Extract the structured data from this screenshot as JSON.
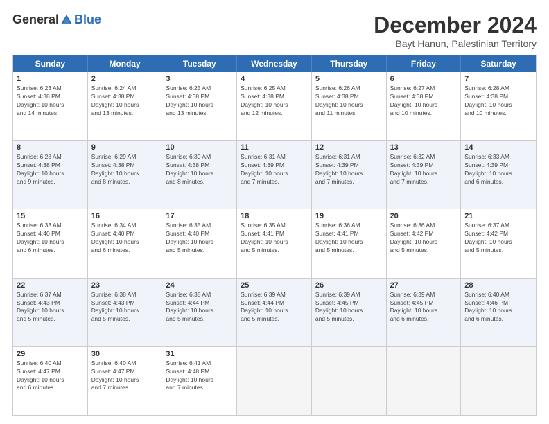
{
  "logo": {
    "general": "General",
    "blue": "Blue"
  },
  "title": "December 2024",
  "subtitle": "Bayt Hanun, Palestinian Territory",
  "days_of_week": [
    "Sunday",
    "Monday",
    "Tuesday",
    "Wednesday",
    "Thursday",
    "Friday",
    "Saturday"
  ],
  "weeks": [
    [
      {
        "day": "1",
        "info": "Sunrise: 6:23 AM\nSunset: 4:38 PM\nDaylight: 10 hours\nand 14 minutes.",
        "shade": false
      },
      {
        "day": "2",
        "info": "Sunrise: 6:24 AM\nSunset: 4:38 PM\nDaylight: 10 hours\nand 13 minutes.",
        "shade": false
      },
      {
        "day": "3",
        "info": "Sunrise: 6:25 AM\nSunset: 4:38 PM\nDaylight: 10 hours\nand 13 minutes.",
        "shade": false
      },
      {
        "day": "4",
        "info": "Sunrise: 6:25 AM\nSunset: 4:38 PM\nDaylight: 10 hours\nand 12 minutes.",
        "shade": false
      },
      {
        "day": "5",
        "info": "Sunrise: 6:26 AM\nSunset: 4:38 PM\nDaylight: 10 hours\nand 11 minutes.",
        "shade": false
      },
      {
        "day": "6",
        "info": "Sunrise: 6:27 AM\nSunset: 4:38 PM\nDaylight: 10 hours\nand 10 minutes.",
        "shade": false
      },
      {
        "day": "7",
        "info": "Sunrise: 6:28 AM\nSunset: 4:38 PM\nDaylight: 10 hours\nand 10 minutes.",
        "shade": false
      }
    ],
    [
      {
        "day": "8",
        "info": "Sunrise: 6:28 AM\nSunset: 4:38 PM\nDaylight: 10 hours\nand 9 minutes.",
        "shade": true
      },
      {
        "day": "9",
        "info": "Sunrise: 6:29 AM\nSunset: 4:38 PM\nDaylight: 10 hours\nand 8 minutes.",
        "shade": true
      },
      {
        "day": "10",
        "info": "Sunrise: 6:30 AM\nSunset: 4:38 PM\nDaylight: 10 hours\nand 8 minutes.",
        "shade": true
      },
      {
        "day": "11",
        "info": "Sunrise: 6:31 AM\nSunset: 4:39 PM\nDaylight: 10 hours\nand 7 minutes.",
        "shade": true
      },
      {
        "day": "12",
        "info": "Sunrise: 6:31 AM\nSunset: 4:39 PM\nDaylight: 10 hours\nand 7 minutes.",
        "shade": true
      },
      {
        "day": "13",
        "info": "Sunrise: 6:32 AM\nSunset: 4:39 PM\nDaylight: 10 hours\nand 7 minutes.",
        "shade": true
      },
      {
        "day": "14",
        "info": "Sunrise: 6:33 AM\nSunset: 4:39 PM\nDaylight: 10 hours\nand 6 minutes.",
        "shade": true
      }
    ],
    [
      {
        "day": "15",
        "info": "Sunrise: 6:33 AM\nSunset: 4:40 PM\nDaylight: 10 hours\nand 6 minutes.",
        "shade": false
      },
      {
        "day": "16",
        "info": "Sunrise: 6:34 AM\nSunset: 4:40 PM\nDaylight: 10 hours\nand 6 minutes.",
        "shade": false
      },
      {
        "day": "17",
        "info": "Sunrise: 6:35 AM\nSunset: 4:40 PM\nDaylight: 10 hours\nand 5 minutes.",
        "shade": false
      },
      {
        "day": "18",
        "info": "Sunrise: 6:35 AM\nSunset: 4:41 PM\nDaylight: 10 hours\nand 5 minutes.",
        "shade": false
      },
      {
        "day": "19",
        "info": "Sunrise: 6:36 AM\nSunset: 4:41 PM\nDaylight: 10 hours\nand 5 minutes.",
        "shade": false
      },
      {
        "day": "20",
        "info": "Sunrise: 6:36 AM\nSunset: 4:42 PM\nDaylight: 10 hours\nand 5 minutes.",
        "shade": false
      },
      {
        "day": "21",
        "info": "Sunrise: 6:37 AM\nSunset: 4:42 PM\nDaylight: 10 hours\nand 5 minutes.",
        "shade": false
      }
    ],
    [
      {
        "day": "22",
        "info": "Sunrise: 6:37 AM\nSunset: 4:43 PM\nDaylight: 10 hours\nand 5 minutes.",
        "shade": true
      },
      {
        "day": "23",
        "info": "Sunrise: 6:38 AM\nSunset: 4:43 PM\nDaylight: 10 hours\nand 5 minutes.",
        "shade": true
      },
      {
        "day": "24",
        "info": "Sunrise: 6:38 AM\nSunset: 4:44 PM\nDaylight: 10 hours\nand 5 minutes.",
        "shade": true
      },
      {
        "day": "25",
        "info": "Sunrise: 6:39 AM\nSunset: 4:44 PM\nDaylight: 10 hours\nand 5 minutes.",
        "shade": true
      },
      {
        "day": "26",
        "info": "Sunrise: 6:39 AM\nSunset: 4:45 PM\nDaylight: 10 hours\nand 5 minutes.",
        "shade": true
      },
      {
        "day": "27",
        "info": "Sunrise: 6:39 AM\nSunset: 4:45 PM\nDaylight: 10 hours\nand 6 minutes.",
        "shade": true
      },
      {
        "day": "28",
        "info": "Sunrise: 6:40 AM\nSunset: 4:46 PM\nDaylight: 10 hours\nand 6 minutes.",
        "shade": true
      }
    ],
    [
      {
        "day": "29",
        "info": "Sunrise: 6:40 AM\nSunset: 4:47 PM\nDaylight: 10 hours\nand 6 minutes.",
        "shade": false
      },
      {
        "day": "30",
        "info": "Sunrise: 6:40 AM\nSunset: 4:47 PM\nDaylight: 10 hours\nand 7 minutes.",
        "shade": false
      },
      {
        "day": "31",
        "info": "Sunrise: 6:41 AM\nSunset: 4:48 PM\nDaylight: 10 hours\nand 7 minutes.",
        "shade": false
      },
      {
        "day": "",
        "info": "",
        "shade": false,
        "empty": true
      },
      {
        "day": "",
        "info": "",
        "shade": false,
        "empty": true
      },
      {
        "day": "",
        "info": "",
        "shade": false,
        "empty": true
      },
      {
        "day": "",
        "info": "",
        "shade": false,
        "empty": true
      }
    ]
  ]
}
